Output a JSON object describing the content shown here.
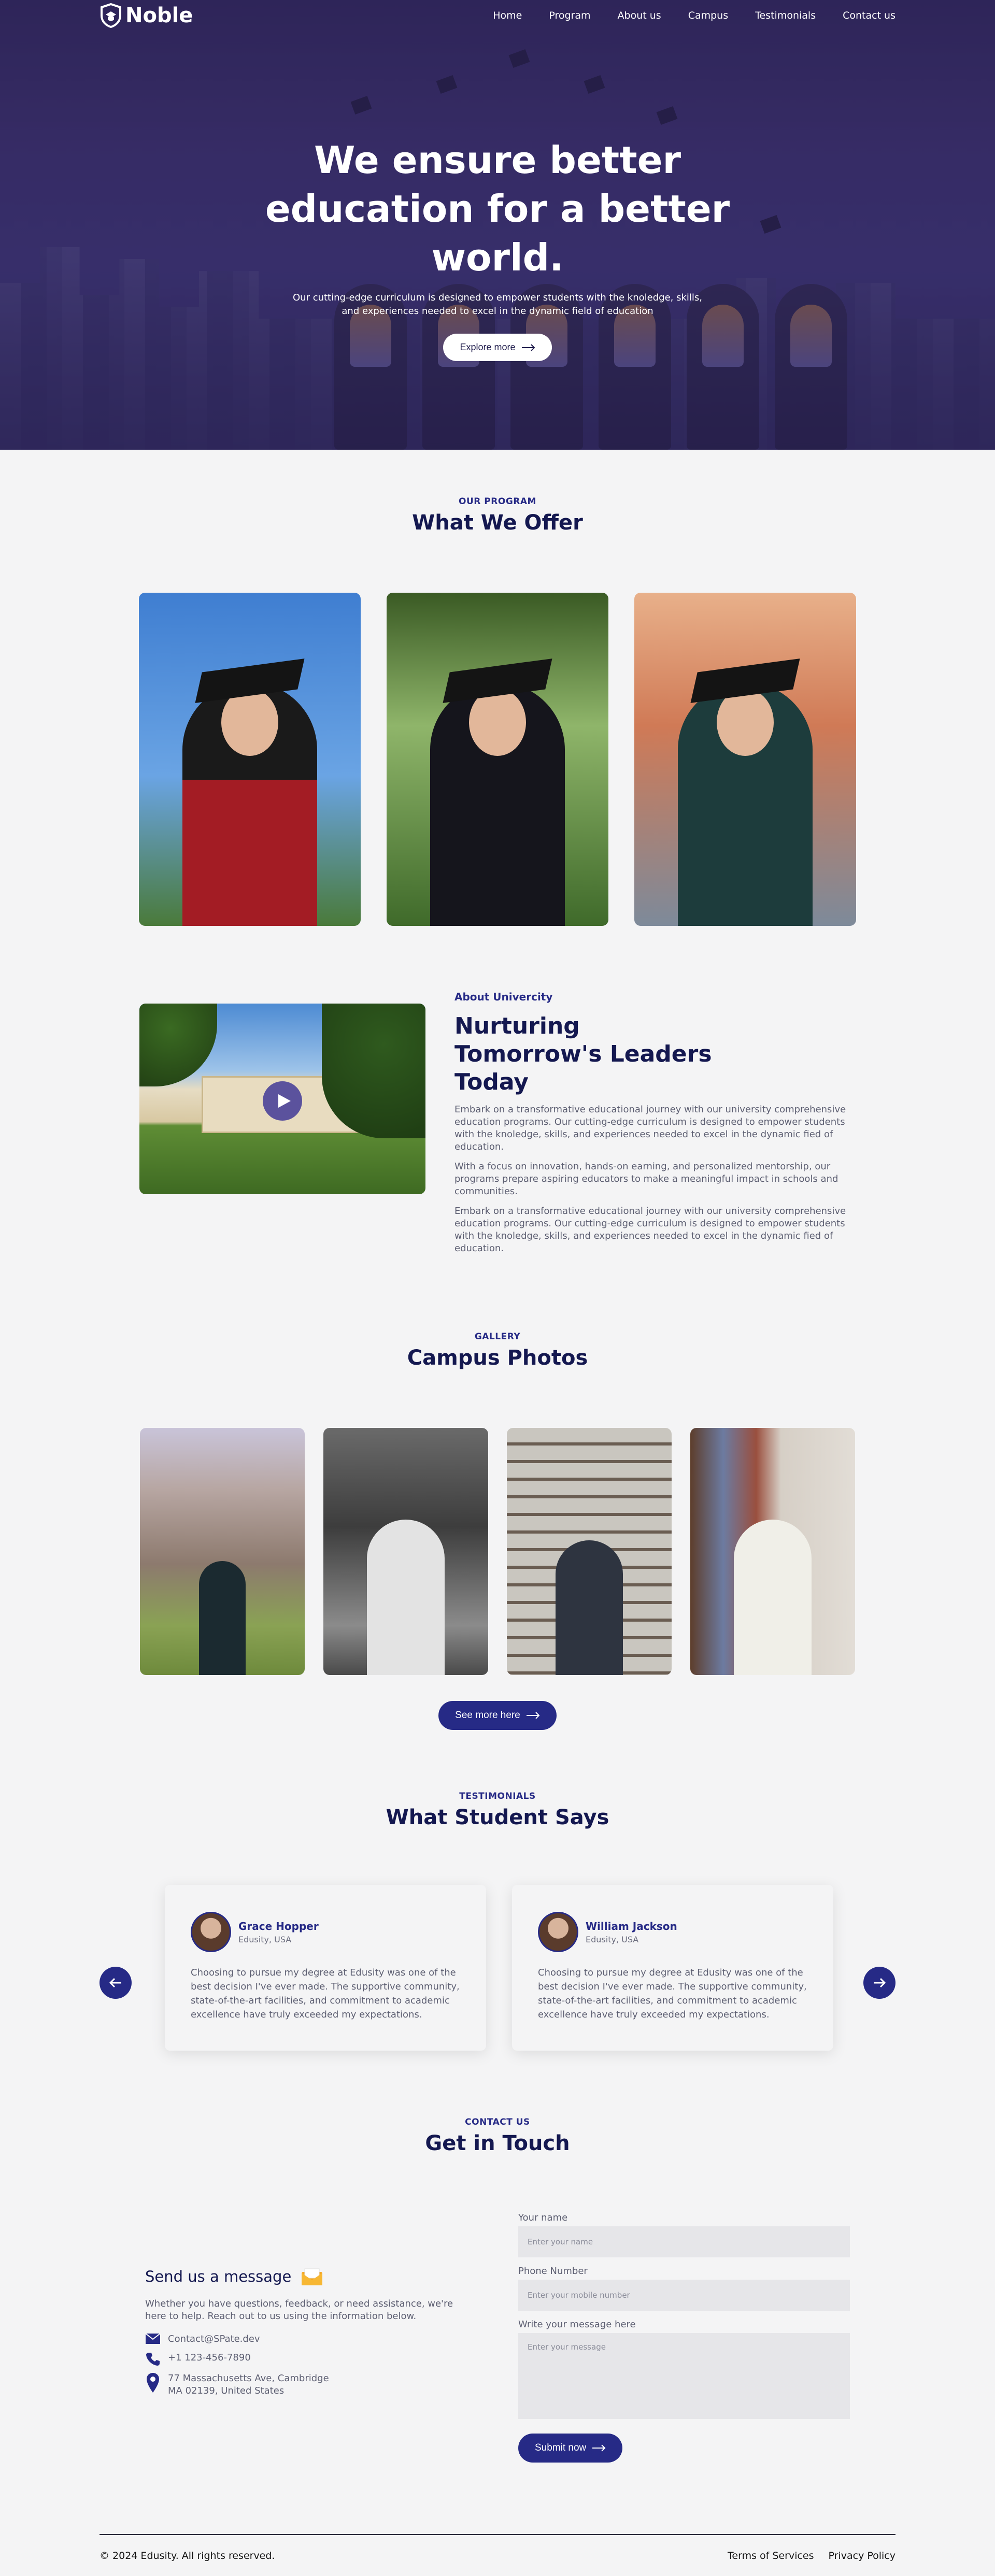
{
  "nav": {
    "logo": "Noble",
    "links": [
      "Home",
      "Program",
      "About us",
      "Campus",
      "Testimonials",
      "Contact us"
    ]
  },
  "hero": {
    "title": "We ensure better education for a better world.",
    "subtitle": "Our cutting-edge curriculum is designed to empower students with the knoledge, skills, and experiences needed to excel in the dynamic field of education",
    "button": "Explore more"
  },
  "program": {
    "eyebrow": "OUR PROGRAM",
    "title": "What We Offer"
  },
  "about": {
    "eyebrow": "About Univercity",
    "title": "Nurturing Tomorrow's Leaders Today",
    "paragraphs": [
      "Embark on a transformative educational journey with our university comprehensive education programs. Our cutting-edge curriculum is designed to empower students with the knoledge, skills, and experiences needed to excel in the dynamic fied of education.",
      "With a focus on innovation, hands-on earning, and personalized mentorship, our programs prepare aspiring educators to make a meaningful impact in schools and communities.",
      "Embark on a transformative educational journey with our university comprehensive education programs. Our cutting-edge curriculum is designed to empower students with the knoledge, skills, and experiences needed to excel in the dynamic fied of education."
    ]
  },
  "gallery": {
    "eyebrow": "GALLERY",
    "title": "Campus Photos",
    "button": "See more here"
  },
  "testimonials": {
    "eyebrow": "TESTIMONIALS",
    "title": "What Student Says",
    "items": [
      {
        "name": "Grace Hopper",
        "location": "Edusity, USA",
        "text": "Choosing to pursue my degree at Edusity was one of the best decision I've ever made. The supportive community, state-of-the-art facilities, and commitment to academic excellence have truly exceeded my expectations."
      },
      {
        "name": "William Jackson",
        "location": "Edusity, USA",
        "text": "Choosing to pursue my degree at Edusity was one of the best decision I've ever made. The supportive community, state-of-the-art facilities, and commitment to academic excellence have truly exceeded my expectations."
      }
    ]
  },
  "contact": {
    "eyebrow": "CONTACT US",
    "title": "Get in Touch",
    "info_title": "Send us a message",
    "info_text": "Whether you have questions, feedback, or need assistance, we're here to help. Reach out to us using the information below.",
    "email": "Contact@SPate.dev",
    "phone": "+1 123-456-7890",
    "address_line1": "77 Massachusetts Ave, Cambridge",
    "address_line2": "MA 02139, United States",
    "form": {
      "name_label": "Your name",
      "name_placeholder": "Enter your name",
      "phone_label": "Phone Number",
      "phone_placeholder": "Enter your mobile number",
      "message_label": "Write your message here",
      "message_placeholder": "Enter your message",
      "submit": "Submit now"
    }
  },
  "footer": {
    "copyright": "© 2024 Edusity. All rights reserved.",
    "links": [
      "Terms of Services",
      "Privacy Policy"
    ]
  },
  "colors": {
    "accent": "#262a86",
    "heading": "#141850",
    "body_text": "#5d5f72",
    "background": "#f4f4f5"
  }
}
